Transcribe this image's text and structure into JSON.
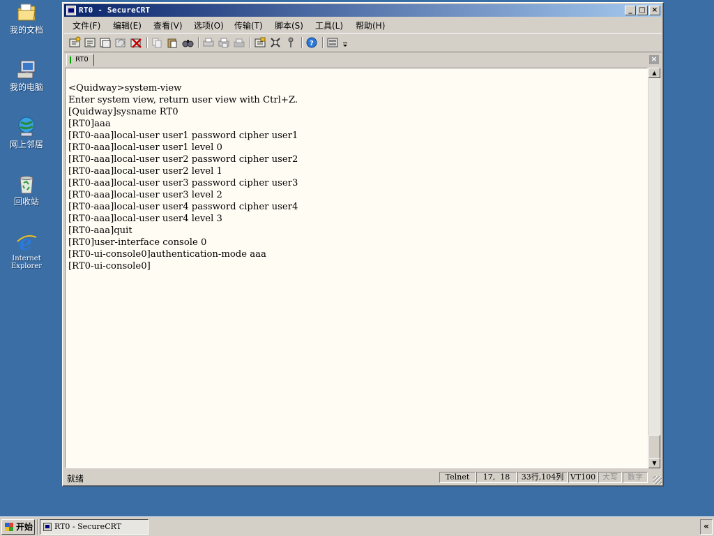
{
  "desktop": {
    "icons": [
      {
        "label": "我的文档",
        "icon": "my-documents-folder-icon"
      },
      {
        "label": "我的电脑",
        "icon": "my-computer-icon"
      },
      {
        "label": "网上邻居",
        "icon": "network-places-icon"
      },
      {
        "label": "回收站",
        "icon": "recycle-bin-icon"
      },
      {
        "label": "Internet Explorer",
        "icon": "internet-explorer-icon"
      }
    ]
  },
  "window": {
    "title": "RT0 - SecureCRT",
    "buttons": {
      "minimize": "_",
      "maximize": "□",
      "close": "×"
    }
  },
  "menu": [
    {
      "label": "文件(F)"
    },
    {
      "label": "编辑(E)"
    },
    {
      "label": "查看(V)"
    },
    {
      "label": "选项(O)"
    },
    {
      "label": "传输(T)"
    },
    {
      "label": "脚本(S)"
    },
    {
      "label": "工具(L)"
    },
    {
      "label": "帮助(H)"
    }
  ],
  "tab": {
    "label": "RT0",
    "close": "×"
  },
  "terminal": {
    "lines": [
      "<Quidway>system-view",
      "Enter system view, return user view with Ctrl+Z.",
      "[Quidway]sysname RT0",
      "[RT0]aaa",
      "[RT0-aaa]local-user user1 password cipher user1",
      "[RT0-aaa]local-user user1 level 0",
      "[RT0-aaa]local-user user2 password cipher user2",
      "[RT0-aaa]local-user user2 level 1",
      "[RT0-aaa]local-user user3 password cipher user3",
      "[RT0-aaa]local-user user3 level 2",
      "[RT0-aaa]local-user user4 password cipher user4",
      "[RT0-aaa]local-user user4 level 3",
      "[RT0-aaa]quit",
      "[RT0]user-interface console 0",
      "[RT0-ui-console0]authentication-mode aaa",
      "[RT0-ui-console0]"
    ]
  },
  "status": {
    "ready": "就绪",
    "protocol": "Telnet",
    "cursor": "17,  18",
    "size": "33行,104列",
    "emulation": "VT100",
    "caps": "大写",
    "num": "数字"
  },
  "taskbar": {
    "start": "开始",
    "task": "RT0 - SecureCRT",
    "tray": "«"
  }
}
